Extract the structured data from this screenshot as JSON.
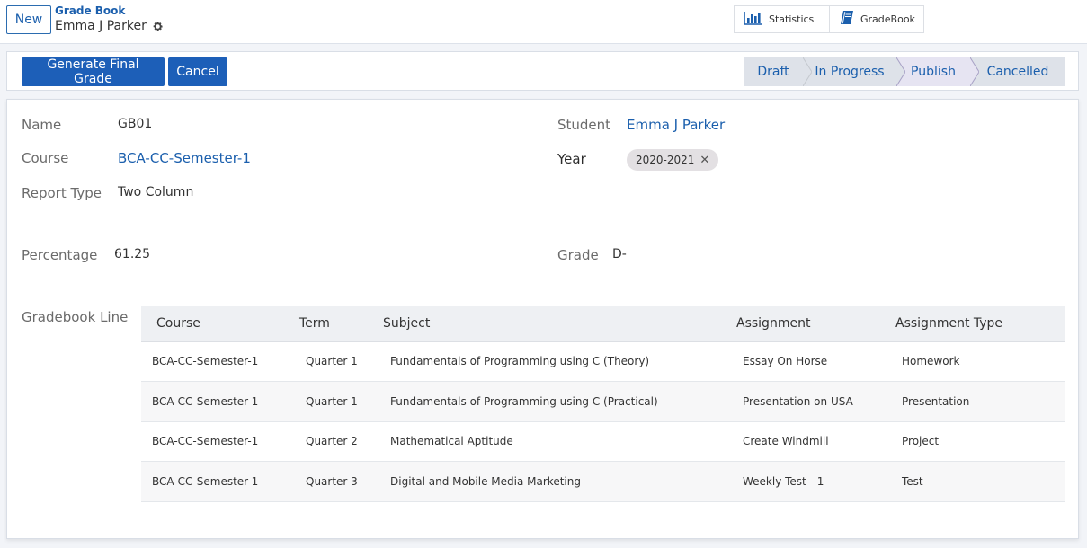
{
  "topbar": {
    "new_label": "New",
    "breadcrumb_parent": "Grade Book",
    "breadcrumb_current": "Emma J Parker",
    "smart_buttons": {
      "statistics": "Statistics",
      "gradebook": "GradeBook"
    }
  },
  "actions": {
    "generate_label": "Generate Final Grade",
    "cancel_label": "Cancel"
  },
  "statusbar": {
    "stages": [
      "Draft",
      "In Progress",
      "Publish",
      "Cancelled"
    ],
    "active": "Publish"
  },
  "form": {
    "name_label": "Name",
    "name_value": "GB01",
    "course_label": "Course",
    "course_value": "BCA-CC-Semester-1",
    "report_type_label": "Report Type",
    "report_type_value": "Two Column",
    "student_label": "Student",
    "student_value": "Emma J Parker",
    "year_label": "Year",
    "year_value": "2020-2021",
    "percentage_label": "Percentage",
    "percentage_value": "61.25",
    "grade_label": "Grade",
    "grade_value": "D-",
    "gradebook_line_label": "Gradebook Line"
  },
  "table": {
    "columns": [
      "Course",
      "Term",
      "Subject",
      "Assignment",
      "Assignment Type"
    ],
    "rows": [
      [
        "BCA-CC-Semester-1",
        "Quarter 1",
        "Fundamentals of Programming using C (Theory)",
        "Essay On Horse",
        "Homework"
      ],
      [
        "BCA-CC-Semester-1",
        "Quarter 1",
        "Fundamentals of Programming using C (Practical)",
        "Presentation on USA",
        "Presentation"
      ],
      [
        "BCA-CC-Semester-1",
        "Quarter 2",
        "Mathematical Aptitude",
        "Create Windmill",
        "Project"
      ],
      [
        "BCA-CC-Semester-1",
        "Quarter 3",
        "Digital and Mobile Media Marketing",
        "Weekly Test - 1",
        "Test"
      ]
    ]
  },
  "colors": {
    "primary": "#1d5fb8",
    "link": "#1b5fad",
    "active_stage": "#e6e4f2"
  }
}
